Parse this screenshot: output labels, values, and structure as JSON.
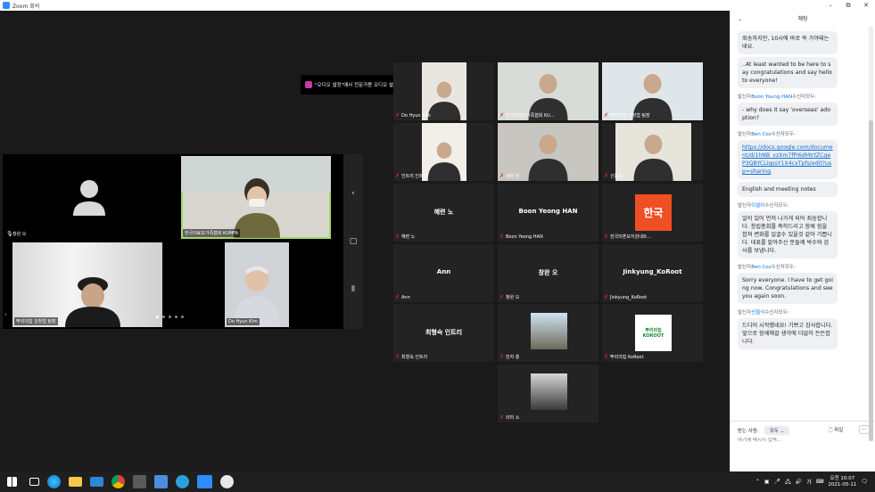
{
  "window": {
    "title": "Zoom 회의",
    "minimize": "–",
    "maximize": "⧉",
    "close": "✕"
  },
  "tooltip": {
    "text": "\"오디오 설정\"에서 전문가용 오디오 설정"
  },
  "left_panel": {
    "tiles": [
      {
        "label": "창완 오"
      },
      {
        "label": "한국이료모가족협회 KUMFA"
      },
      {
        "label": "뿌리의집 김창엽 팀장"
      },
      {
        "label": "Do Hyun Kim"
      }
    ]
  },
  "gallery": [
    {
      "label": "Do Hyun Kim",
      "type": "video"
    },
    {
      "label": "한국미혼모가족협회 KU...",
      "type": "video"
    },
    {
      "label": "뿌리의집 김창엽 팀장",
      "type": "video"
    },
    {
      "label": "인트리 인트리",
      "type": "video"
    },
    {
      "label": "세희 전",
      "type": "video"
    },
    {
      "label": "신동초",
      "type": "video"
    },
    {
      "label": "혜련 노",
      "type": "name"
    },
    {
      "label": "Boon Yeong HAN",
      "type": "name"
    },
    {
      "label": "한국미혼모지원네트...",
      "type": "logo",
      "logo_text": "한국"
    },
    {
      "label": "Ann",
      "type": "name"
    },
    {
      "label": "창완 오",
      "type": "name"
    },
    {
      "label": "Jinkyung_KoRoot",
      "type": "name"
    },
    {
      "label": "최형숙 인트리",
      "type": "name"
    },
    {
      "label": "민자 홍",
      "type": "image"
    },
    {
      "label": "뿌리의집 KoRoot",
      "type": "logo",
      "logo_text": "뿌리의집 KOROOT"
    },
    {
      "label": "라미 소",
      "type": "image"
    }
  ],
  "chat": {
    "title": "채팅",
    "messages": [
      {
        "sender": "",
        "text": "죄송하지만, 10시에 바로 쏙 가야돼는데요."
      },
      {
        "sender": "",
        "text": "..At least wanted to be here to say congratulations and say hello to everyone!"
      },
      {
        "sender_prefix": "발신자",
        "sender": "Boon Young HAN",
        "sender_suffix": "수신자모두:",
        "text": "- why does it say 'overseas' adoption?"
      },
      {
        "sender_prefix": "발신자",
        "sender": "Ben Coz",
        "sender_suffix": "수신자모두:",
        "text": "https://docs.google.com/document/d/1hNB_vzXm7fPi6dMIrtZCgeP3QBYCLiqssY1X4cxTpfs/edit?usp=sharing",
        "link": true
      },
      {
        "sender": "",
        "text": "English and meeting notes"
      },
      {
        "sender_prefix": "발신자",
        "sender": "이설아",
        "sender_suffix": "수신자모두:",
        "text": "일이 있어 먼저 나가게 되어 죄송합니다. 창립총회를 축하드리고 함께 힘을 합쳐 변화를 일굴수 있을것 같아 기쁩니다. 대표를 맡아주신 분들께 박수와 감사를 보냅니다."
      },
      {
        "sender_prefix": "발신자",
        "sender": "Ben Coz",
        "sender_suffix": "수신자모두:",
        "text": "Sorry everyone. I have to get going now. Congratulations and see you again soon."
      },
      {
        "sender_prefix": "발신자",
        "sender": "신필식",
        "sender_suffix": "수신자모두:",
        "text": "드디어 시작했네요! 기쁘고 감사합니다. 앞으로 함께해갈 생각에 더없이 든든합니다."
      }
    ],
    "to_label": "받는 사람:",
    "to_value": "모두",
    "file_label": "파일",
    "more": "...",
    "input_placeholder": "여기에 메시지 입력..."
  },
  "taskbar": {
    "time": "오전 10:07",
    "date": "2021-05-11",
    "lang": "가"
  }
}
